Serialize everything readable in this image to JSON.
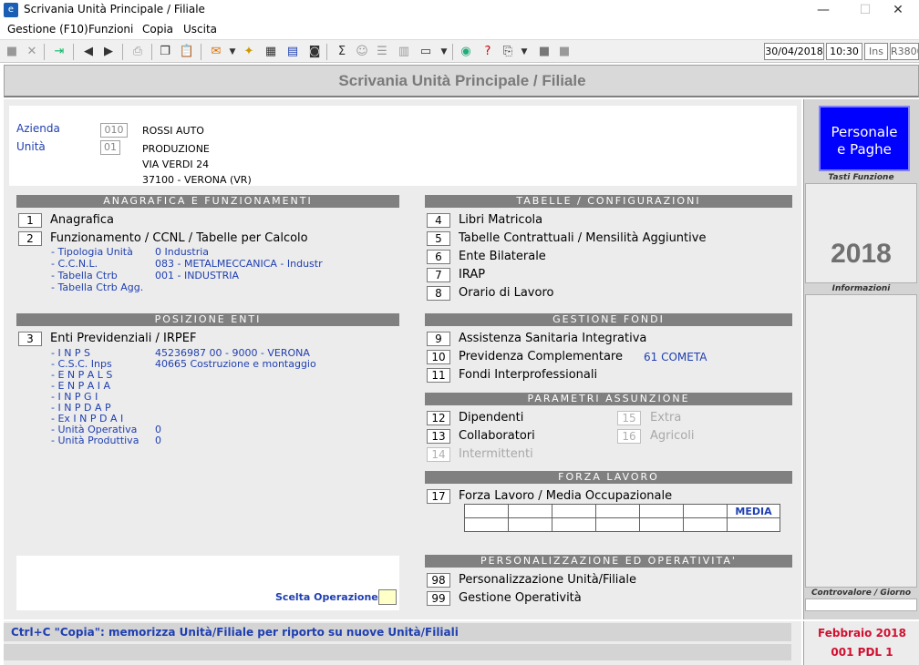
{
  "window": {
    "title": "Scrivania Unità Principale / Filiale",
    "minimize": "—",
    "maximize": "☐",
    "close": "✕"
  },
  "menu": [
    "Gestione (F10)",
    "Funzioni",
    "Copia",
    "Uscita"
  ],
  "status": {
    "date": "30/04/2018",
    "time": "10:30",
    "ins": "Ins",
    "user": "R3800"
  },
  "header": {
    "title": "Scrivania Unità Principale / Filiale"
  },
  "info": {
    "azienda_label": "Azienda",
    "azienda_code": "010",
    "azienda_name": "ROSSI AUTO",
    "unita_label": "Unità",
    "unita_code": "01",
    "unita_name": "PRODUZIONE",
    "address1": "VIA VERDI 24",
    "address2": "37100 - VERONA (VR)"
  },
  "anagrafica": {
    "title": "ANAGRAFICA E FUNZIONAMENTI",
    "i1": {
      "n": "1",
      "label": "Anagrafica"
    },
    "i2": {
      "n": "2",
      "label": "Funzionamento / CCNL / Tabelle per Calcolo"
    },
    "sub": [
      {
        "k": "- Tipologia Unità",
        "v": "0  Industria"
      },
      {
        "k": "- C.C.N.L.",
        "v": "083  - METALMECCANICA   - Industr"
      },
      {
        "k": "- Tabella Ctrb",
        "v": "001  - INDUSTRIA"
      },
      {
        "k": "- Tabella Ctrb Agg.",
        "v": ""
      }
    ]
  },
  "posizione": {
    "title": "POSIZIONE ENTI",
    "i3": {
      "n": "3",
      "label": "Enti Previdenziali / IRPEF"
    },
    "sub": [
      {
        "k": "- I N P S",
        "v": "45236987   00 - 9000 - VERONA"
      },
      {
        "k": "- C.S.C. Inps",
        "v": "40665  Costruzione e montaggio"
      },
      {
        "k": "- E N P A L S",
        "v": ""
      },
      {
        "k": "- E N P A I A",
        "v": ""
      },
      {
        "k": "- I N P G I",
        "v": ""
      },
      {
        "k": "- I N P D A P",
        "v": ""
      },
      {
        "k": "- Ex  I N P D A I",
        "v": ""
      },
      {
        "k": "- Unità Operativa",
        "v": "0"
      },
      {
        "k": "- Unità Produttiva",
        "v": "0"
      }
    ]
  },
  "tabelle": {
    "title": "TABELLE / CONFIGURAZIONI",
    "items": [
      {
        "n": "4",
        "label": "Libri Matricola"
      },
      {
        "n": "5",
        "label": "Tabelle Contrattuali / Mensilità Aggiuntive"
      },
      {
        "n": "6",
        "label": "Ente Bilaterale"
      },
      {
        "n": "7",
        "label": "IRAP"
      },
      {
        "n": "8",
        "label": "Orario di Lavoro"
      }
    ]
  },
  "fondi": {
    "title": "GESTIONE FONDI",
    "items": [
      {
        "n": "9",
        "label": "Assistenza Sanitaria Integrativa"
      },
      {
        "n": "10",
        "label": "Previdenza Complementare",
        "extra": "61 COMETA"
      },
      {
        "n": "11",
        "label": "Fondi Interprofessionali"
      }
    ]
  },
  "assunzione": {
    "title": "PARAMETRI ASSUNZIONE",
    "i12": {
      "n": "12",
      "label": "Dipendenti"
    },
    "i13": {
      "n": "13",
      "label": "Collaboratori"
    },
    "i14": {
      "n": "14",
      "label": "Intermittenti"
    },
    "i15": {
      "n": "15",
      "label": "Extra"
    },
    "i16": {
      "n": "16",
      "label": "Agricoli"
    }
  },
  "forza": {
    "title": "FORZA LAVORO",
    "i17": {
      "n": "17",
      "label": "Forza Lavoro / Media Occupazionale"
    },
    "media": "MEDIA"
  },
  "personalizzazione": {
    "title": "PERSONALIZZAZIONE ED OPERATIVITA'",
    "i98": {
      "n": "98",
      "label": "Personalizzazione Unità/Filiale"
    },
    "i99": {
      "n": "99",
      "label": "Gestione Operatività"
    }
  },
  "scelta": {
    "label": "Scelta Operazione",
    "value": ""
  },
  "sidebar": {
    "logo_line1": "Personale",
    "logo_line2": "e Paghe",
    "tasti": "Tasti Funzione",
    "year": "2018",
    "informazioni": "Informazioni",
    "controvalore": "Controvalore / Giorno"
  },
  "footer": {
    "message": "Ctrl+C \"Copia\": memorizza Unità/Filiale per riporto su nuove Unità/Filiali",
    "period": "Febbraio  2018",
    "code": "001 PDL 1"
  }
}
